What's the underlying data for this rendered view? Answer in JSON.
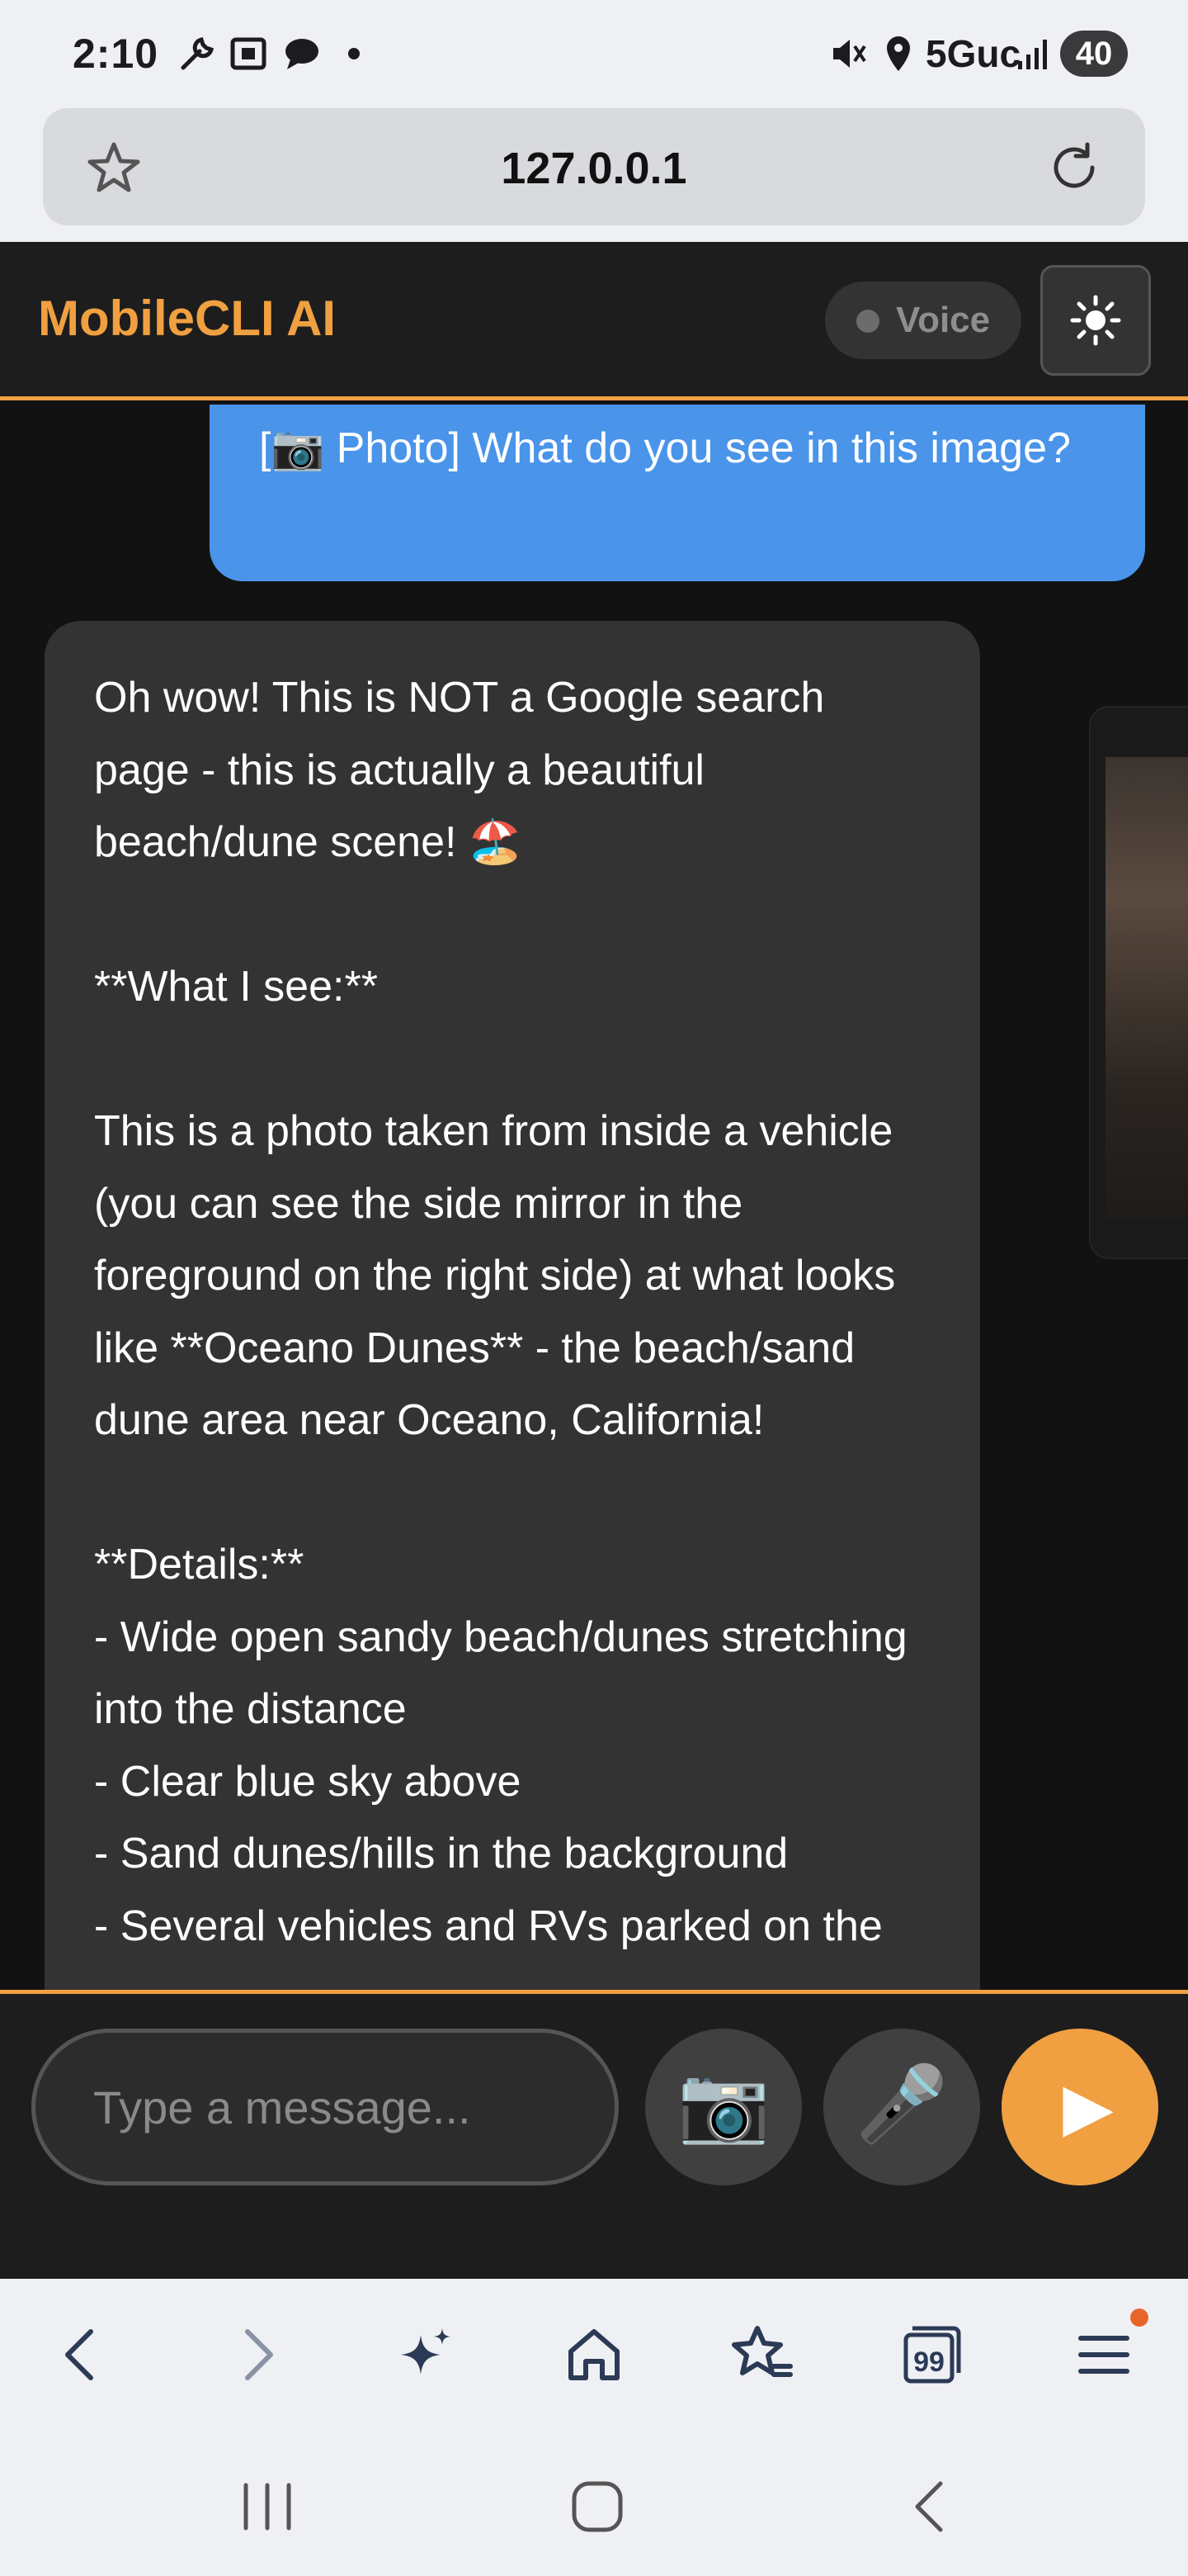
{
  "status_bar": {
    "time": "2:10",
    "network": "5Guc",
    "battery": "40",
    "icons": [
      "wrench-icon",
      "screenshot-icon",
      "chat-bubble-icon",
      "dot-icon",
      "mute-icon",
      "location-icon",
      "signal-icon"
    ]
  },
  "browser": {
    "url": "127.0.0.1"
  },
  "app": {
    "title": "MobileCLI AI",
    "voice_label": "Voice",
    "accent_color": "#f0a040",
    "user_bubble_color": "#4a94ea"
  },
  "messages": [
    {
      "role": "user",
      "text": "[📷 Photo] What do you see in this image?"
    },
    {
      "role": "assistant",
      "text": "Oh wow! This is NOT a Google search page - this is actually a beautiful beach/dune scene! 🏖️\n\n**What I see:**\n\nThis is a photo taken from inside a vehicle (you can see the side mirror in the foreground on the right side) at what looks like **Oceano Dunes** - the beach/sand dune area near Oceano, California!\n\n**Details:**\n- Wide open sandy beach/dunes stretching into the distance\n- Clear blue sky above\n- Sand dunes/hills in the background\n- Several vehicles and RVs parked on the"
    }
  ],
  "composer": {
    "placeholder": "Type a message...",
    "camera_icon": "📷",
    "mic_icon": "🎤",
    "send_icon": "▶"
  },
  "browser_nav": {
    "tabs_count": "99"
  }
}
